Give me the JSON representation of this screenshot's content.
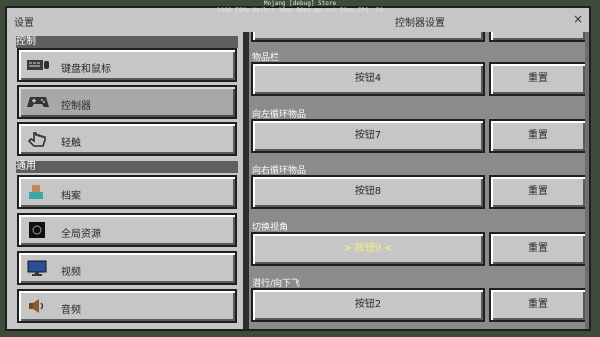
{
  "overlay": {
    "line1": "Mojang [debug] Store",
    "line2": "1000 FSMs Ns(hrs 10ms 50ms,ms-ret 50ms,FPS: 59"
  },
  "window": {
    "left_title": "设置",
    "center_title": "控制器设置",
    "close_glyph": "×"
  },
  "sidebar": {
    "sections": [
      {
        "label": "控制"
      },
      {
        "label": "通用"
      }
    ],
    "items": [
      {
        "label": "键盘和鼠标",
        "icon": "keyboard-mouse-icon"
      },
      {
        "label": "控制器",
        "icon": "gamepad-icon",
        "active": true
      },
      {
        "label": "轻触",
        "icon": "touch-hand-icon"
      },
      {
        "label": "档案",
        "icon": "profile-icon"
      },
      {
        "label": "全局资源",
        "icon": "global-resources-icon"
      },
      {
        "label": "视频",
        "icon": "monitor-icon"
      },
      {
        "label": "音频",
        "icon": "speaker-icon"
      }
    ]
  },
  "bindings": [
    {
      "label": "物品栏",
      "button": "按钮4",
      "reset": "重置"
    },
    {
      "label": "向左循环物品",
      "button": "按钮7",
      "reset": "重置"
    },
    {
      "label": "向右循环物品",
      "button": "按钮8",
      "reset": "重置"
    },
    {
      "label": "切换视角",
      "button": "> 按钮9 <",
      "reset": "重置",
      "selected": true
    },
    {
      "label": "潜行/向下飞",
      "button": "按钮2",
      "reset": "重置"
    }
  ],
  "colors": {
    "panel": "#c6c6c6",
    "content_bg": "#8b8b8b",
    "selected_text": "#f2f27a"
  }
}
